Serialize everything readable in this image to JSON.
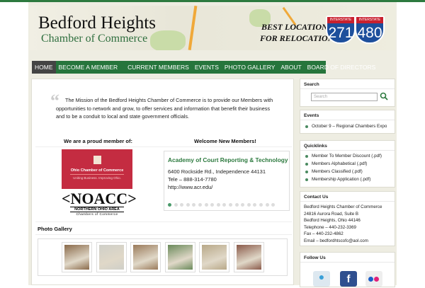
{
  "header": {
    "title": "Bedford Heights",
    "subtitle": "Chamber of Commerce",
    "slogan1": "BEST LOCATION...",
    "slogan2": "FOR RELOCATION!",
    "shield1": "271",
    "shield2": "480",
    "shield_label": "INTERSTATE"
  },
  "nav": [
    "HOME",
    "BECOME A MEMBER",
    "CURRENT MEMBERS",
    "EVENTS",
    "PHOTO GALLERY",
    "ABOUT",
    "BOARD OF DIRECTORS"
  ],
  "mission": "The Mission of the Bedford Heights Chamber of Commerce is to provide our Members with opportunities to network and grow, to offer services and information that benefit their business and to be a conduit to local and state government officials.",
  "member_heading": "We are a proud member of:",
  "ohio": {
    "name": "Ohio Chamber of Commerce",
    "tagline": "Uniting Business. Improving Ohio."
  },
  "noacc": {
    "name": "<NOACC>",
    "line1": "NORTHERN OHIO AREA",
    "line2": "Chambers of Commerce"
  },
  "welcome": {
    "heading": "Welcome New Members!",
    "name": "Academy of Court Reporting & Technology",
    "address": "6400 Rockside Rd., Independence 44131",
    "phone": "Tele – 888-314-7780",
    "url": "http://www.acr.edu/",
    "slide_count": 18,
    "active_slide": 1
  },
  "gallery": {
    "heading": "Photo Gallery",
    "photos": [
      "#8a6a4a",
      "#cfcfc8",
      "#9a7a5a",
      "#6a8a5a",
      "#b8a888",
      "#8a5a4a"
    ]
  },
  "sidebar": {
    "search": {
      "title": "Search",
      "placeholder": "Search"
    },
    "events": {
      "title": "Events",
      "items": [
        "October 9 – Regional Chambers Expo"
      ]
    },
    "quicklinks": {
      "title": "Quicklinks",
      "items": [
        "Member To Member Discount (.pdf)",
        "Members Alphabetical (.pdf)",
        "Members Classified (.pdf)",
        "Membership Application (.pdf)"
      ]
    },
    "contact": {
      "title": "Contact Us",
      "lines": [
        "Bedford Heights Chamber of Commerce",
        "24816 Aurora Road, Suite B",
        "Bedford Heights, Ohio 44146",
        "Telephone – 440-232-3369",
        "Fax – 440-232-4862",
        "Email – bedfordhtscofc@aol.com"
      ]
    },
    "follow": {
      "title": "Follow Us"
    }
  },
  "colors": {
    "green": "#26753c",
    "ohio_red": "#c42c41"
  }
}
